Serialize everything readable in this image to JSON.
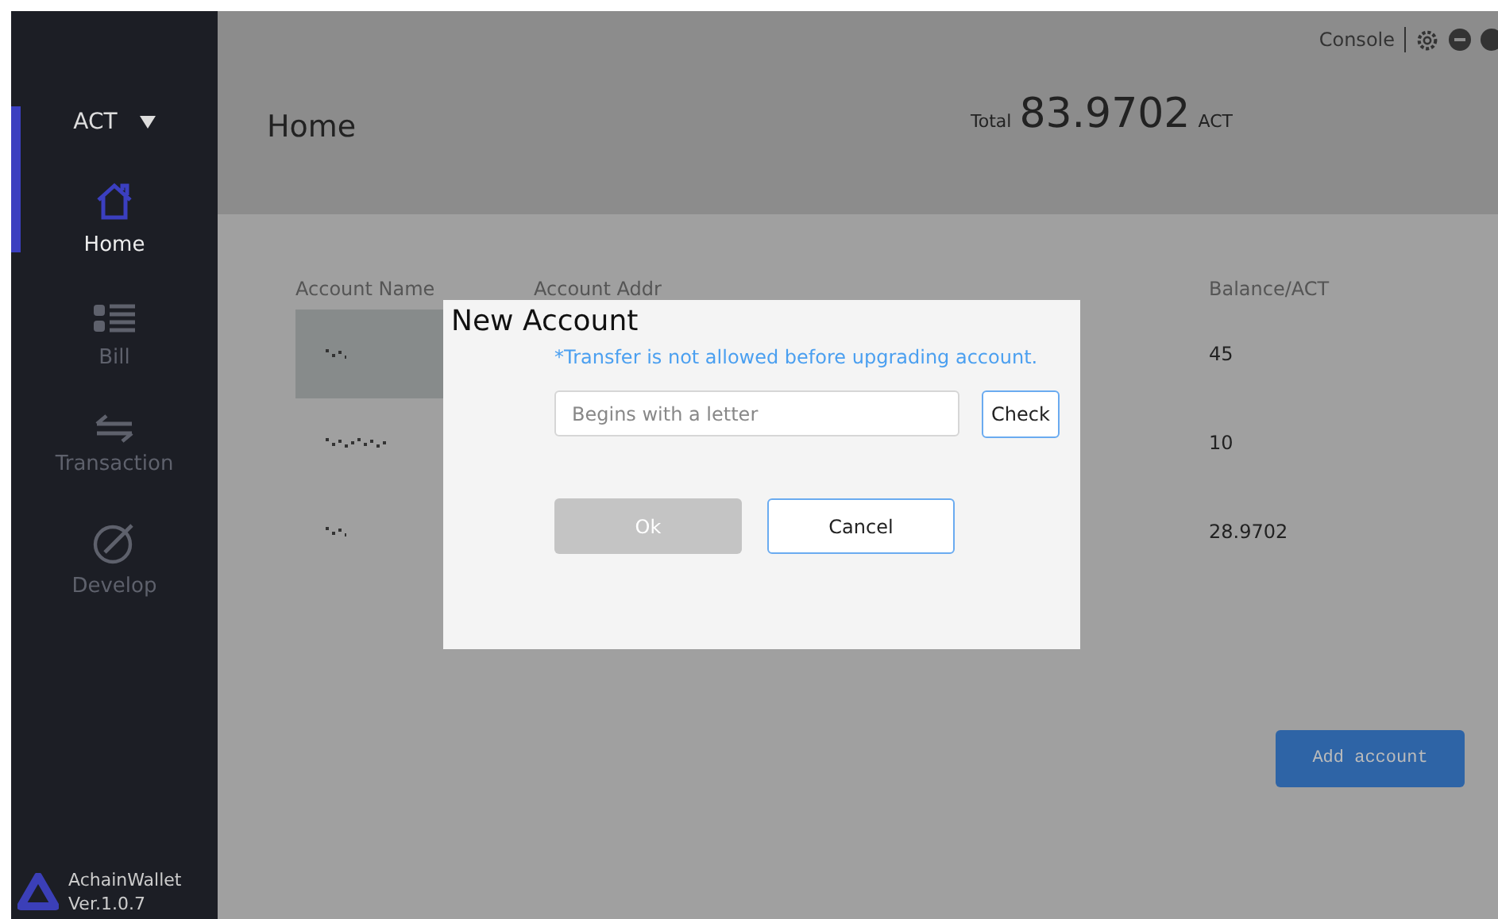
{
  "sidebar": {
    "currency": "ACT",
    "items": [
      {
        "label": "Home",
        "selected": true
      },
      {
        "label": "Bill",
        "selected": false
      },
      {
        "label": "Transaction",
        "selected": false
      },
      {
        "label": "Develop",
        "selected": false
      }
    ],
    "app_name": "AchainWallet",
    "version": "Ver.1.0.7"
  },
  "topbar": {
    "console": "Console"
  },
  "header": {
    "title": "Home",
    "total_label": "Total",
    "total": "83.9702",
    "unit": "ACT"
  },
  "table": {
    "columns": [
      "Account Name",
      "Account Addr",
      "Balance/ACT"
    ],
    "rows": [
      {
        "balance": "45",
        "selected": true
      },
      {
        "balance": "10",
        "selected": false
      },
      {
        "balance": "28.9702",
        "selected": false
      }
    ]
  },
  "add_button": "Add account",
  "dialog": {
    "title": "New Account",
    "notice": "*Transfer is not allowed before upgrading account.",
    "placeholder": "Begins with a letter",
    "check": "Check",
    "ok": "Ok",
    "ok_disabled": true,
    "cancel": "Cancel"
  }
}
